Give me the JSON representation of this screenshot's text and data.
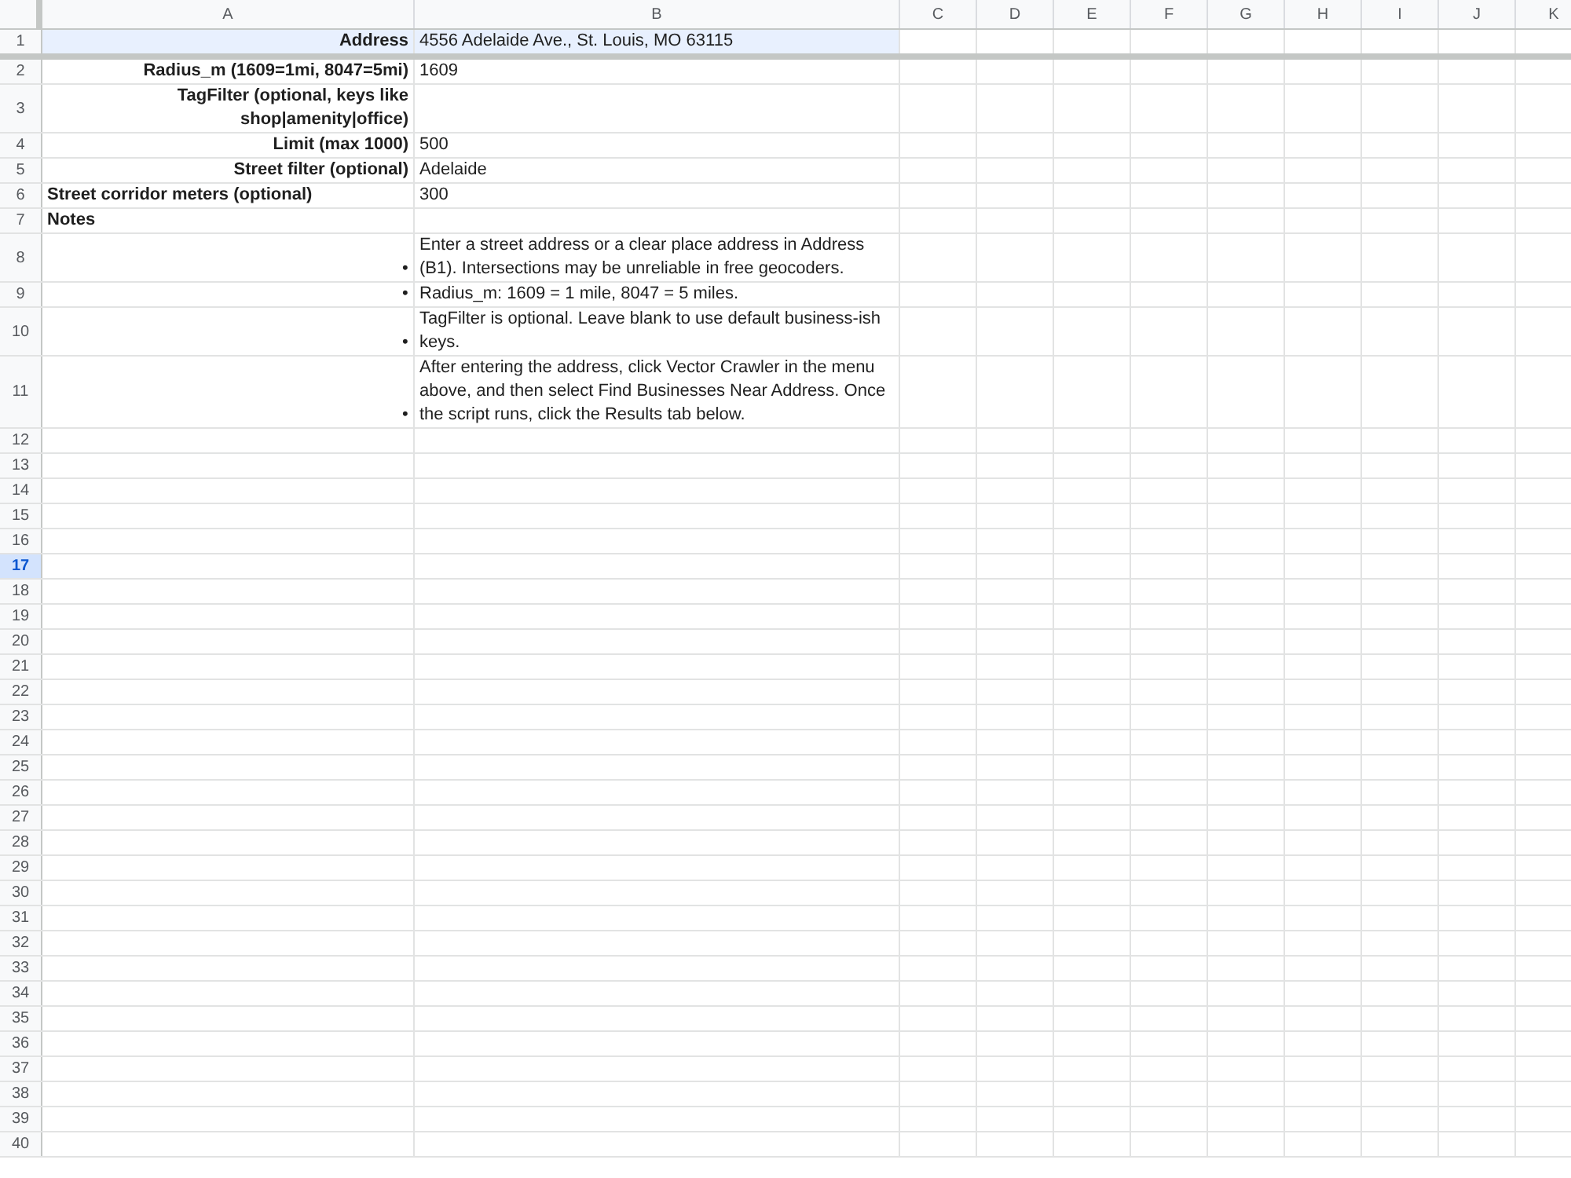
{
  "columns": [
    "A",
    "B",
    "C",
    "D",
    "E",
    "F",
    "G",
    "H",
    "I",
    "J",
    "K"
  ],
  "rows": [
    {
      "number": "1",
      "selected": false,
      "highlighted": true,
      "frozen": true,
      "cells": [
        {
          "text": "Address",
          "kind": "label"
        },
        {
          "text": "4556 Adelaide Ave., St. Louis, MO 63115"
        }
      ]
    },
    {
      "number": "2",
      "selected": false,
      "highlighted": false,
      "frozen": false,
      "cells": [
        {
          "text": "Radius_m (1609=1mi, 8047=5mi)",
          "kind": "label"
        },
        {
          "text": "1609"
        }
      ]
    },
    {
      "number": "3",
      "selected": false,
      "highlighted": false,
      "frozen": false,
      "cells": [
        {
          "text": "TagFilter (optional, keys like shop|amenity|office)",
          "kind": "label"
        },
        {}
      ]
    },
    {
      "number": "4",
      "selected": false,
      "highlighted": false,
      "frozen": false,
      "cells": [
        {
          "text": "Limit (max 1000)",
          "kind": "label"
        },
        {
          "text": "500"
        }
      ]
    },
    {
      "number": "5",
      "selected": false,
      "highlighted": false,
      "frozen": false,
      "cells": [
        {
          "text": "Street filter (optional)",
          "kind": "label"
        },
        {
          "text": "Adelaide"
        }
      ]
    },
    {
      "number": "6",
      "selected": false,
      "highlighted": false,
      "frozen": false,
      "cells": [
        {
          "text": "Street corridor meters (optional)",
          "kind": "heading"
        },
        {
          "text": "300"
        }
      ]
    },
    {
      "number": "7",
      "selected": false,
      "highlighted": false,
      "frozen": false,
      "cells": [
        {
          "text": "Notes",
          "kind": "heading"
        },
        {}
      ]
    },
    {
      "number": "8",
      "selected": false,
      "highlighted": false,
      "frozen": false,
      "cells": [
        {},
        {
          "bullet": "•",
          "text": "Enter a street address or a clear place address in Address (B1). Intersections may be unreliable in free geocoders."
        }
      ]
    },
    {
      "number": "9",
      "selected": false,
      "highlighted": false,
      "frozen": false,
      "cells": [
        {},
        {
          "bullet": "•",
          "text": "Radius_m: 1609 = 1 mile, 8047 = 5 miles."
        }
      ]
    },
    {
      "number": "10",
      "selected": false,
      "highlighted": false,
      "frozen": false,
      "cells": [
        {},
        {
          "bullet": "•",
          "text": "TagFilter is optional. Leave blank to use default business-ish keys."
        }
      ]
    },
    {
      "number": "11",
      "selected": false,
      "highlighted": false,
      "frozen": false,
      "cells": [
        {},
        {
          "bullet": "•",
          "text": "After entering the address, click Vector Crawler in the menu above, and then select Find Businesses Near Address. Once the script runs, click the Results tab below."
        }
      ]
    },
    {
      "number": "12",
      "selected": false,
      "highlighted": false,
      "frozen": false
    },
    {
      "number": "13",
      "selected": false,
      "highlighted": false,
      "frozen": false
    },
    {
      "number": "14",
      "selected": false,
      "highlighted": false,
      "frozen": false
    },
    {
      "number": "15",
      "selected": false,
      "highlighted": false,
      "frozen": false
    },
    {
      "number": "16",
      "selected": false,
      "highlighted": false,
      "frozen": false
    },
    {
      "number": "17",
      "selected": true,
      "highlighted": false,
      "frozen": false
    },
    {
      "number": "18",
      "selected": false,
      "highlighted": false,
      "frozen": false
    },
    {
      "number": "19",
      "selected": false,
      "highlighted": false,
      "frozen": false
    },
    {
      "number": "20",
      "selected": false,
      "highlighted": false,
      "frozen": false
    },
    {
      "number": "21",
      "selected": false,
      "highlighted": false,
      "frozen": false
    },
    {
      "number": "22",
      "selected": false,
      "highlighted": false,
      "frozen": false
    },
    {
      "number": "23",
      "selected": false,
      "highlighted": false,
      "frozen": false
    },
    {
      "number": "24",
      "selected": false,
      "highlighted": false,
      "frozen": false
    },
    {
      "number": "25",
      "selected": false,
      "highlighted": false,
      "frozen": false
    },
    {
      "number": "26",
      "selected": false,
      "highlighted": false,
      "frozen": false
    },
    {
      "number": "27",
      "selected": false,
      "highlighted": false,
      "frozen": false
    },
    {
      "number": "28",
      "selected": false,
      "highlighted": false,
      "frozen": false
    },
    {
      "number": "29",
      "selected": false,
      "highlighted": false,
      "frozen": false
    },
    {
      "number": "30",
      "selected": false,
      "highlighted": false,
      "frozen": false
    },
    {
      "number": "31",
      "selected": false,
      "highlighted": false,
      "frozen": false
    },
    {
      "number": "32",
      "selected": false,
      "highlighted": false,
      "frozen": false
    },
    {
      "number": "33",
      "selected": false,
      "highlighted": false,
      "frozen": false
    },
    {
      "number": "34",
      "selected": false,
      "highlighted": false,
      "frozen": false
    },
    {
      "number": "35",
      "selected": false,
      "highlighted": false,
      "frozen": false
    },
    {
      "number": "36",
      "selected": false,
      "highlighted": false,
      "frozen": false
    },
    {
      "number": "37",
      "selected": false,
      "highlighted": false,
      "frozen": false
    },
    {
      "number": "38",
      "selected": false,
      "highlighted": false,
      "frozen": false
    },
    {
      "number": "39",
      "selected": false,
      "highlighted": false,
      "frozen": false
    },
    {
      "number": "40",
      "selected": false,
      "highlighted": false,
      "frozen": false
    }
  ]
}
